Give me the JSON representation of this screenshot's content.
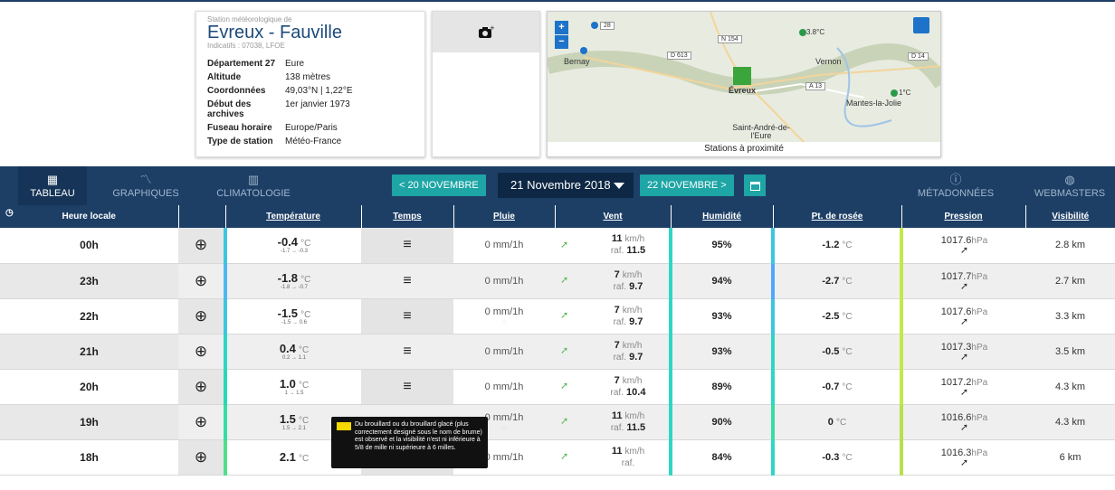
{
  "station": {
    "subtitle": "Station météorologique de",
    "name": "Evreux - Fauville",
    "codes": "Indicatifs : 07038, LFOE",
    "details": [
      {
        "k": "Département 27",
        "v": "Eure"
      },
      {
        "k": "Altitude",
        "v": "138 mètres"
      },
      {
        "k": "Coordonnées",
        "v": "49,03°N | 1,22°E"
      },
      {
        "k": "Début des archives",
        "v": "1er janvier 1973"
      },
      {
        "k": "Fuseau horaire",
        "v": "Europe/Paris"
      },
      {
        "k": "Type de station",
        "v": "Météo-France"
      }
    ]
  },
  "map": {
    "footer": "Stations à proximité",
    "cities": [
      "Bernay",
      "Évreux",
      "Vernon",
      "Mantes-la-Jolie",
      "Saint-André-de-l'Eure"
    ],
    "roads": [
      "28",
      "N 154",
      "D 613",
      "D 14",
      "A 13"
    ],
    "temps": [
      "3.8°C",
      "1°C"
    ]
  },
  "nav": {
    "tabs": [
      "TABLEAU",
      "GRAPHIQUES",
      "CLIMATOLOGIE"
    ],
    "right_tabs": [
      "MÉTADONNÉES",
      "WEBMASTERS"
    ],
    "prev_date": "< 20 NOVEMBRE",
    "current_date": "21 Novembre 2018",
    "next_date": "22 NOVEMBRE >"
  },
  "table": {
    "headers": {
      "hour": "Heure locale",
      "temp": "Température",
      "wx": "Temps",
      "rain": "Pluie",
      "wind": "Vent",
      "hum": "Humidité",
      "dew": "Pt. de rosée",
      "pres": "Pression",
      "vis": "Visibilité"
    },
    "rows": [
      {
        "h": "00h",
        "t": "-0.4",
        "tr": "-1.7 → -0.3",
        "rain": "0 mm/1h",
        "ws": "11",
        "gust": "11.5",
        "hum": "95%",
        "dew": "-1.2",
        "p": "1017.6",
        "vis": "2.8 km"
      },
      {
        "h": "23h",
        "t": "-1.8",
        "tr": "-1.8 → -0.7",
        "rain": "0 mm/1h",
        "ws": "7",
        "gust": "9.7",
        "hum": "94%",
        "dew": "-2.7",
        "p": "1017.7",
        "vis": "2.7 km"
      },
      {
        "h": "22h",
        "t": "-1.5",
        "tr": "-1.5 → 0.6",
        "rain": "0 mm/1h",
        "ws": "7",
        "gust": "9.7",
        "hum": "93%",
        "dew": "-2.5",
        "p": "1017.6",
        "vis": "3.3 km"
      },
      {
        "h": "21h",
        "t": "0.4",
        "tr": "0.2 → 1.1",
        "rain": "0 mm/1h",
        "ws": "7",
        "gust": "9.7",
        "hum": "93%",
        "dew": "-0.5",
        "p": "1017.3",
        "vis": "3.5 km"
      },
      {
        "h": "20h",
        "t": "1.0",
        "tr": "1 → 1.5",
        "rain": "0 mm/1h",
        "ws": "7",
        "gust": "10.4",
        "hum": "89%",
        "dew": "-0.7",
        "p": "1017.2",
        "vis": "4.3 km"
      },
      {
        "h": "19h",
        "t": "1.5",
        "tr": "1.5 → 2.1",
        "rain": "0 mm/1h",
        "ws": "11",
        "gust": "11.5",
        "hum": "90%",
        "dew": "0",
        "p": "1016.6",
        "vis": "4.3 km"
      },
      {
        "h": "18h",
        "t": "2.1",
        "tr": "",
        "rain": "0 mm/1h",
        "ws": "11",
        "gust": "",
        "hum": "84%",
        "dew": "-0.3",
        "p": "1016.3",
        "vis": "6 km"
      }
    ],
    "units": {
      "temp": "°C",
      "wind": "km/h",
      "gust_prefix": "raf.",
      "pres": "hPa"
    }
  },
  "tooltip": "Du brouillard ou du brouillard glacé (plus correctement designé sous le nom de brume) est observé et la visibilité n'est ni inférieure à 5/8 de mille ni supérieure à 6 milles."
}
